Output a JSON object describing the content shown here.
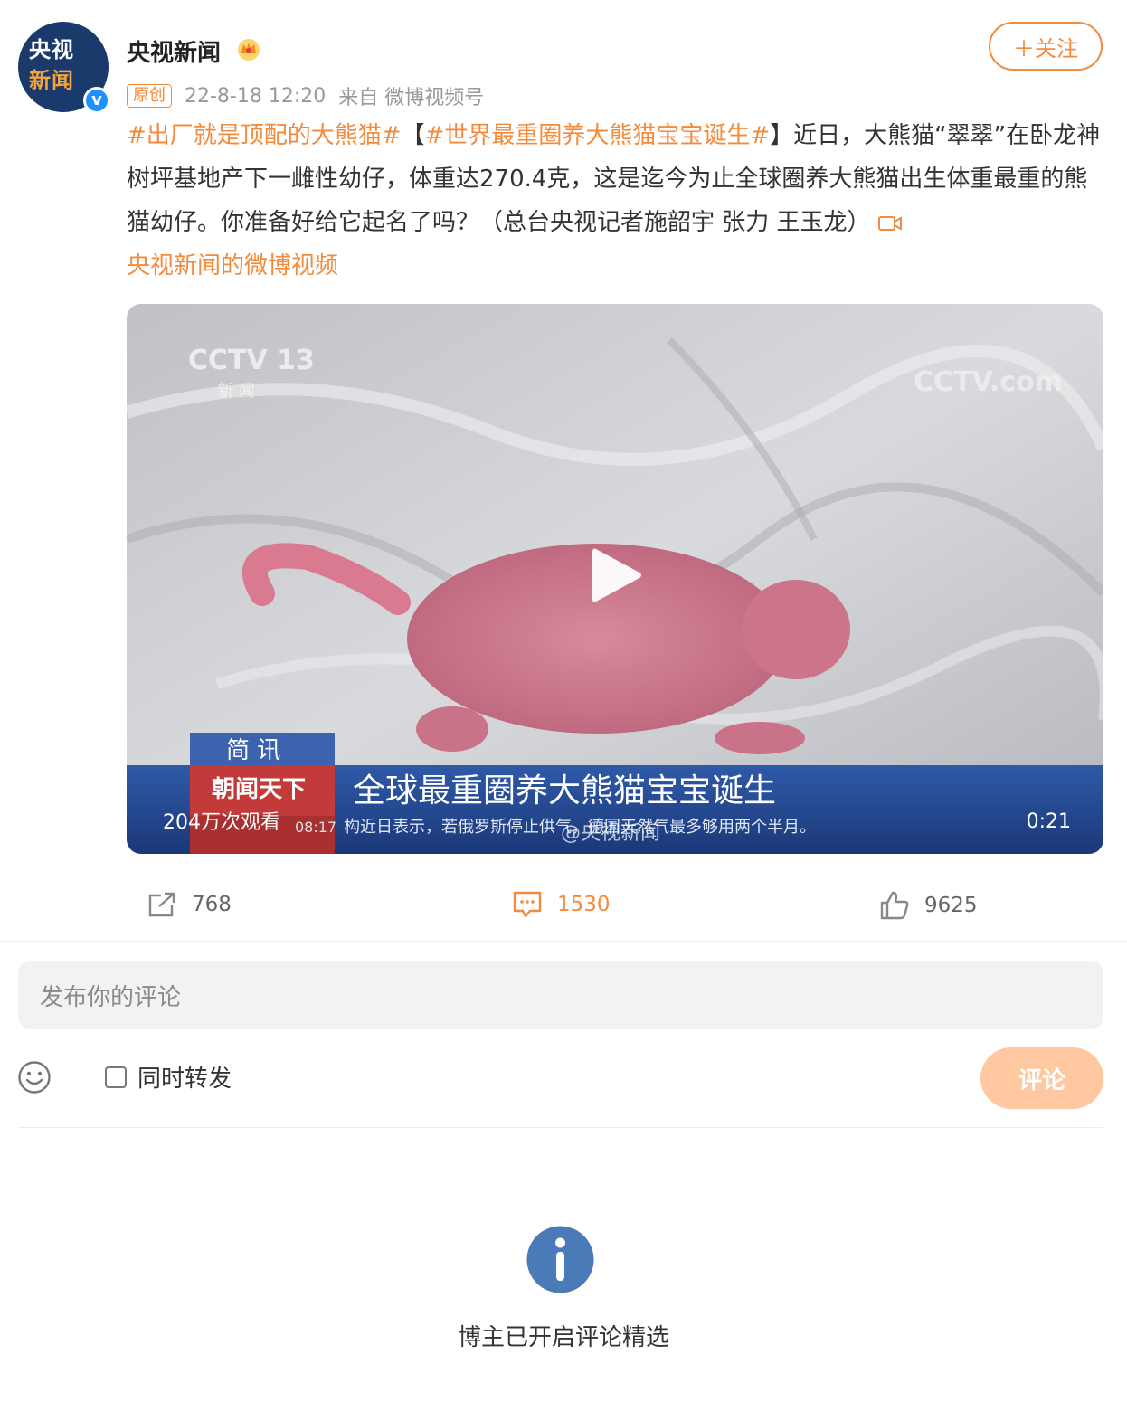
{
  "author": {
    "name": "央视新闻",
    "avatar_text": [
      "央视",
      "新闻"
    ],
    "verified_symbol": "v",
    "badge_icon": "crown-icon"
  },
  "post_meta": {
    "tag": "原创",
    "time": "22-8-18 12:20",
    "source": "来自 微博视频号"
  },
  "follow": {
    "label": "＋关注"
  },
  "content": {
    "topic1": "#出厂就是顶配的大熊猫#",
    "bracket_open": "【",
    "topic2": "#世界最重圈养大熊猫宝宝诞生#",
    "text": "】近日，大熊猫“翠翠”在卧龙神树坪基地产下一雌性幼仔，体重达270.4克，这是迄今为止全球圈养大熊猫出生体重最重的熊猫幼仔。你准备好给它起名了吗？（总台央视记者施韶宇 张力 王玉龙）",
    "video_link": "央视新闻的微博视频"
  },
  "video": {
    "views": "204万次观看",
    "duration": "0:21",
    "overlay": {
      "channel_logo": "CCTV 13",
      "channel_sub": "新 闻",
      "watermark": "CCTV.com",
      "program_tag": "简 讯",
      "program_name": "朝闻天下",
      "headline": "全球最重圈养大熊猫宝宝诞生",
      "clock": "08:17",
      "ticker": "构近日表示，若俄罗斯停止供气，德国天然气最多够用两个半月。",
      "weibo_watermark": "@央视新闻"
    }
  },
  "stats": {
    "reposts": "768",
    "comments": "1530",
    "likes": "9625"
  },
  "comment_form": {
    "placeholder": "发布你的评论",
    "repost_label": "同时转发",
    "submit_label": "评论"
  },
  "notice": {
    "text": "博主已开启评论精选"
  },
  "colors": {
    "accent": "#f48b3c",
    "submit_disabled": "#ffc8a0",
    "info_blue": "#4a7ab8"
  }
}
